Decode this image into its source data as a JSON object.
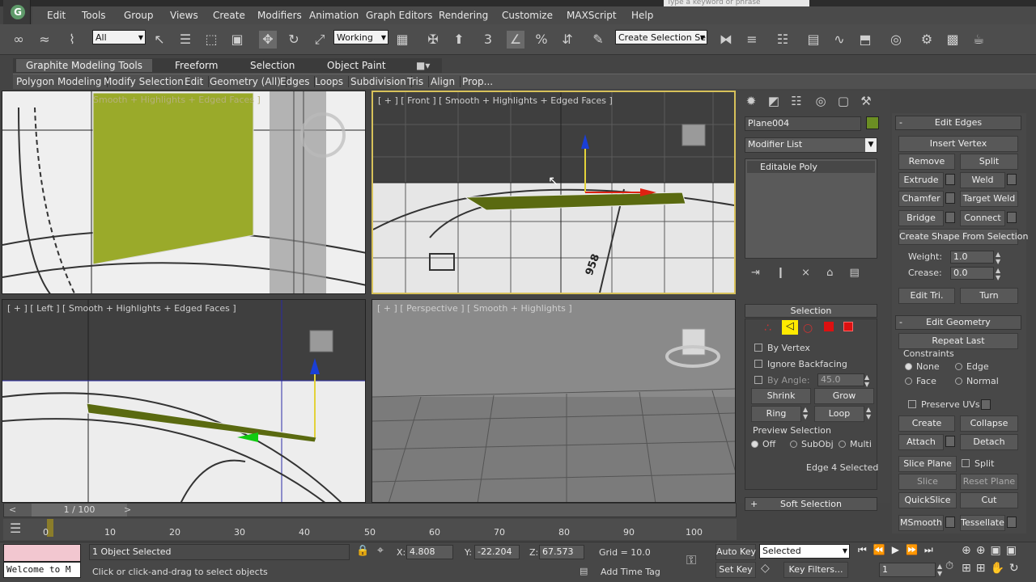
{
  "search": {
    "placeholder": "Type a keyword or phrase"
  },
  "menu": [
    "Edit",
    "Tools",
    "Group",
    "Views",
    "Create",
    "Modifiers",
    "Animation",
    "Graph Editors",
    "Rendering",
    "Customize",
    "MAXScript",
    "Help"
  ],
  "toolbar": {
    "filter_value": "All",
    "coord_value": "Working",
    "selection_set": "Create Selection Se",
    "snap_number": "3",
    "percent_label": "%"
  },
  "ribbon": {
    "tabs": [
      "Graphite Modeling Tools",
      "Freeform",
      "Selection",
      "Object Paint"
    ],
    "panels": [
      "Polygon Modeling",
      "Modify Selection",
      "Edit",
      "Geometry (All)",
      "Edges",
      "Loops",
      "Subdivision",
      "Tris",
      "Align",
      "Prop..."
    ]
  },
  "viewports": {
    "top": "Smooth + Highlights + Edged Faces ]",
    "front": "[ + ] [ Front ] [ Smooth + Highlights + Edged Faces ]",
    "left": "[ + ] [ Left ] [ Smooth + Highlights + Edged Faces ]",
    "persp": "[ + ] [ Perspective ] [ Smooth + Highlights ]",
    "front_number": "958"
  },
  "command_panel": {
    "object_name": "Plane004",
    "object_color": "#6b8e23",
    "modifier_list": "Modifier List",
    "stack_item": "Editable Poly",
    "selection_title": "Selection",
    "by_vertex": "By Vertex",
    "ignore_backfacing": "Ignore Backfacing",
    "by_angle": "By Angle:",
    "angle_value": "45.0",
    "shrink": "Shrink",
    "grow": "Grow",
    "ring": "Ring",
    "loop": "Loop",
    "preview_selection": "Preview Selection",
    "preview_off": "Off",
    "preview_subobj": "SubObj",
    "preview_multi": "Multi",
    "selected_info": "Edge 4 Selected",
    "soft_selection": "Soft Selection"
  },
  "edit_edges": {
    "title": "Edit Edges",
    "insert_vertex": "Insert Vertex",
    "remove": "Remove",
    "split": "Split",
    "extrude": "Extrude",
    "weld": "Weld",
    "chamfer": "Chamfer",
    "target_weld": "Target Weld",
    "bridge": "Bridge",
    "connect": "Connect",
    "create_shape": "Create Shape From Selection",
    "weight_label": "Weight:",
    "weight_value": "1.0",
    "crease_label": "Crease:",
    "crease_value": "0.0",
    "edit_tri": "Edit Tri.",
    "turn": "Turn"
  },
  "edit_geometry": {
    "title": "Edit Geometry",
    "repeat_last": "Repeat Last",
    "constraints": "Constraints",
    "none": "None",
    "edge": "Edge",
    "face": "Face",
    "normal": "Normal",
    "preserve_uvs": "Preserve UVs",
    "create": "Create",
    "collapse": "Collapse",
    "attach": "Attach",
    "detach": "Detach",
    "slice_plane": "Slice Plane",
    "split": "Split",
    "slice": "Slice",
    "reset_plane": "Reset Plane",
    "quickslice": "QuickSlice",
    "cut": "Cut",
    "msmooth": "MSmooth",
    "tessellate": "Tessellate"
  },
  "timeline": {
    "frame": "1 / 100",
    "ticks": [
      "0",
      "10",
      "20",
      "30",
      "40",
      "50",
      "60",
      "70",
      "80",
      "90",
      "100"
    ]
  },
  "status": {
    "welcome": "Welcome to M",
    "selected": "1 Object Selected",
    "prompt": "Click or click-and-drag to select objects",
    "x_label": "X:",
    "x": "4.808",
    "y_label": "Y:",
    "y": "-22.204",
    "z_label": "Z:",
    "z": "67.573",
    "grid": "Grid = 10.0",
    "add_time_tag": "Add Time Tag",
    "auto_key": "Auto Key",
    "key_mode": "Selected",
    "set_key": "Set Key",
    "key_filters": "Key Filters...",
    "current_frame": "1"
  }
}
